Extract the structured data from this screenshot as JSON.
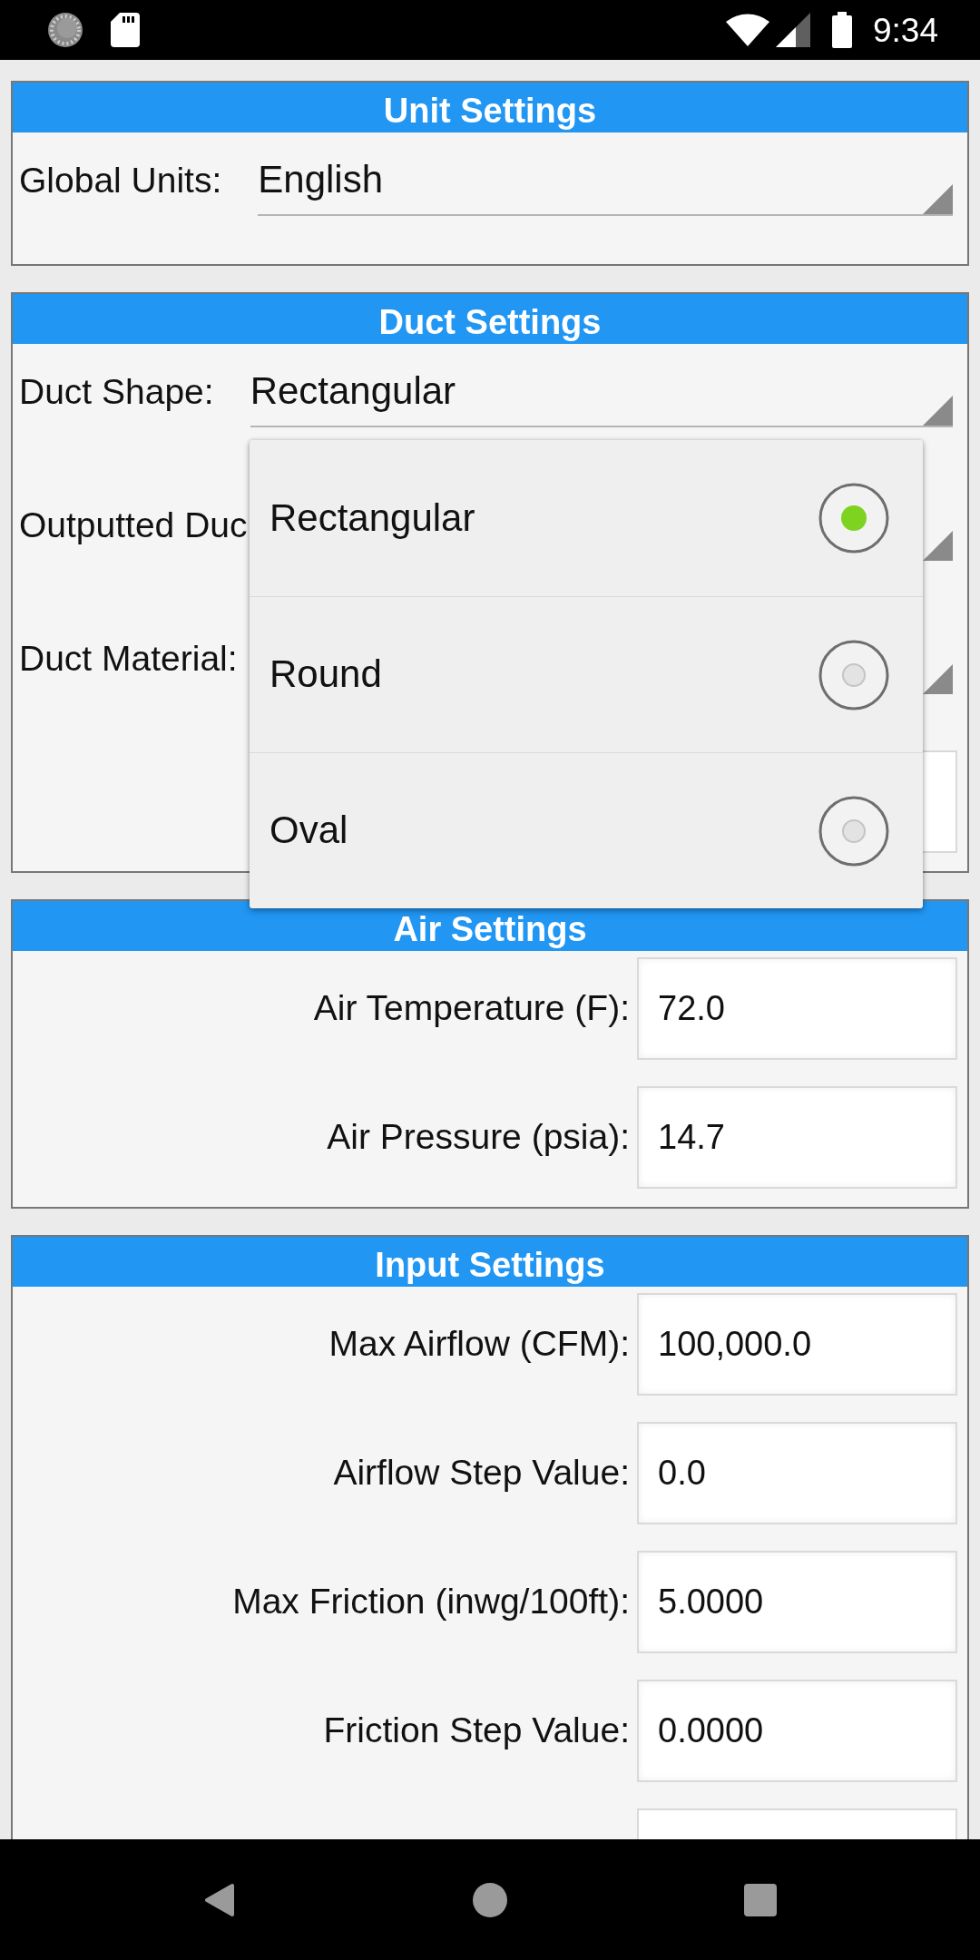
{
  "status_bar": {
    "time": "9:34"
  },
  "sections": [
    {
      "title": "Unit Settings",
      "rows": [
        {
          "kind": "select",
          "label": "Global Units:",
          "value": "English"
        }
      ]
    },
    {
      "title": "Duct Settings",
      "rows": [
        {
          "kind": "select",
          "label": "Duct Shape:",
          "value": "Rectangular"
        },
        {
          "kind": "select-covered",
          "label": "Outputted Duc"
        },
        {
          "kind": "select-covered",
          "label": "Duct Material:"
        },
        {
          "kind": "input-covered"
        }
      ]
    },
    {
      "title": "Air Settings",
      "rows": [
        {
          "kind": "input",
          "label": "Air Temperature (F):",
          "value": "72.0"
        },
        {
          "kind": "input",
          "label": "Air Pressure (psia):",
          "value": "14.7"
        }
      ]
    },
    {
      "title": "Input Settings",
      "rows": [
        {
          "kind": "input",
          "label": "Max Airflow (CFM):",
          "value": "100,000.0"
        },
        {
          "kind": "input",
          "label": "Airflow Step Value:",
          "value": "0.0"
        },
        {
          "kind": "input",
          "label": "Max Friction (inwg/100ft):",
          "value": "5.0000"
        },
        {
          "kind": "input",
          "label": "Friction Step Value:",
          "value": "0.0000"
        },
        {
          "kind": "input-cut"
        }
      ]
    }
  ],
  "dropdown_menu": {
    "options": [
      {
        "label": "Rectangular",
        "selected": true
      },
      {
        "label": "Round",
        "selected": false
      },
      {
        "label": "Oval",
        "selected": false
      }
    ]
  }
}
